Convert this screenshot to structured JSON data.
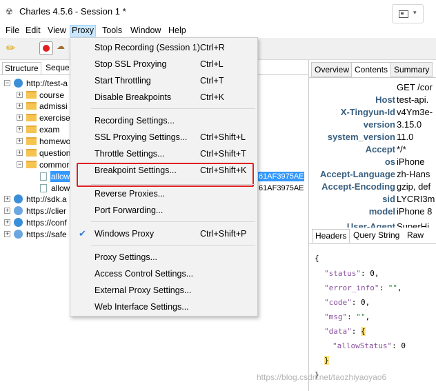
{
  "window": {
    "title": "Charles 4.5.6 - Session 1 *",
    "app_icon": "charles-jar-icon",
    "control_icon": "screenshot-menu-icon"
  },
  "menubar": {
    "items": [
      "File",
      "Edit",
      "View",
      "Proxy",
      "Tools",
      "Window",
      "Help"
    ],
    "active": "Proxy"
  },
  "toolbar": {
    "icons": [
      "broom-icon",
      "record-icon",
      "throttle-icon"
    ]
  },
  "left_panel": {
    "tabs": [
      "Structure",
      "Seque"
    ],
    "tree": {
      "host1": "http://test-a",
      "folders": [
        "course",
        "admissi",
        "exercise",
        "exam",
        "homewo",
        "question",
        "commor"
      ],
      "files": [
        "allow",
        "allow"
      ],
      "hashes": [
        ":61AF3975AE",
        ":61AF3975AE"
      ],
      "hosts": [
        "http://sdk.a",
        "https://clier",
        "https://conf",
        "https://safe"
      ]
    }
  },
  "right_panel": {
    "tabs": [
      "Overview",
      "Contents",
      "Summary"
    ],
    "headers": [
      {
        "key": "",
        "value": "GET /cor"
      },
      {
        "key": "Host",
        "value": "test-api."
      },
      {
        "key": "X-Tingyun-Id",
        "value": "v4Ym3e-"
      },
      {
        "key": "version",
        "value": "3.15.0"
      },
      {
        "key": "system_version",
        "value": "11.0"
      },
      {
        "key": "Accept",
        "value": "*/*"
      },
      {
        "key": "os",
        "value": "iPhone"
      },
      {
        "key": "Accept-Language",
        "value": "zh-Hans"
      },
      {
        "key": "Accept-Encoding",
        "value": "gzip, def"
      },
      {
        "key": "sid",
        "value": "LYCRI3m"
      },
      {
        "key": "model",
        "value": "iPhone 8"
      },
      {
        "key": "User-Agent",
        "value": "SuperHi"
      }
    ],
    "body_tabs": [
      "Headers",
      "Query String",
      "Raw"
    ],
    "json_lines": {
      "open": "{",
      "status_key": "\"status\"",
      "status_val": ": 0,",
      "error_key": "\"error_info\"",
      "error_sep": ": ",
      "error_val": "\"\"",
      "error_end": ",",
      "code_key": "\"code\"",
      "code_val": ": 0,",
      "msg_key": "\"msg\"",
      "msg_sep": ": ",
      "msg_val": "\"\"",
      "msg_end": ",",
      "data_key": "\"data\"",
      "data_sep": ": ",
      "data_open": "{",
      "allow_key": "\"allowStatus\"",
      "allow_val": ": 0",
      "data_close": "}",
      "close": "}"
    }
  },
  "proxy_menu": {
    "items": [
      {
        "label": "Stop Recording (Session 1)",
        "shortcut": "Ctrl+R"
      },
      {
        "label": "Stop SSL Proxying",
        "shortcut": "Ctrl+L"
      },
      {
        "label": "Start Throttling",
        "shortcut": "Ctrl+T"
      },
      {
        "label": "Disable Breakpoints",
        "shortcut": "Ctrl+K"
      },
      {
        "label": "Recording Settings...",
        "shortcut": ""
      },
      {
        "label": "SSL Proxying Settings...",
        "shortcut": "Ctrl+Shift+L"
      },
      {
        "label": "Throttle Settings...",
        "shortcut": "Ctrl+Shift+T"
      },
      {
        "label": "Breakpoint Settings...",
        "shortcut": "Ctrl+Shift+K"
      },
      {
        "label": "Reverse Proxies...",
        "shortcut": ""
      },
      {
        "label": "Port Forwarding...",
        "shortcut": ""
      },
      {
        "label": "Windows Proxy",
        "shortcut": "Ctrl+Shift+P",
        "checked": true
      },
      {
        "label": "Proxy Settings...",
        "shortcut": ""
      },
      {
        "label": "Access Control Settings...",
        "shortcut": ""
      },
      {
        "label": "External Proxy Settings...",
        "shortcut": ""
      },
      {
        "label": "Web Interface Settings...",
        "shortcut": ""
      }
    ],
    "highlight_color": "#e02020"
  },
  "watermark": "https://blog.csdn.net/taozhiyaoyao6"
}
